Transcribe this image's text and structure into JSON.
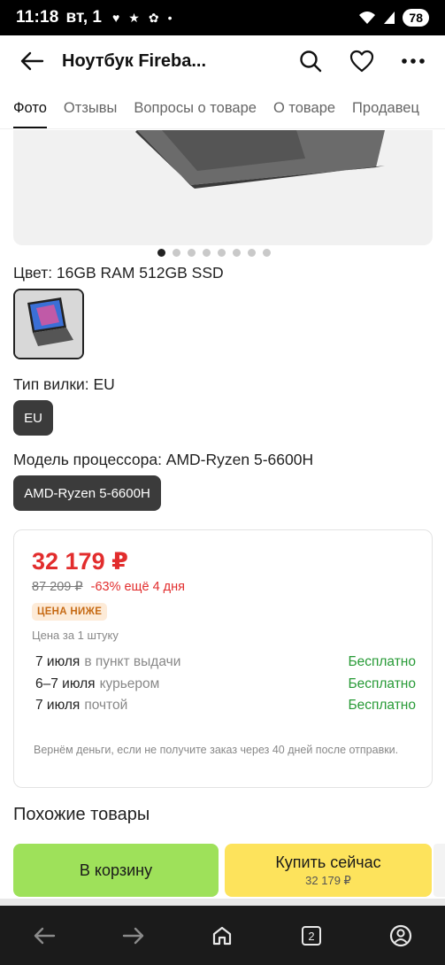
{
  "status_bar": {
    "time": "11:18",
    "day": "вт, 1",
    "battery": "78"
  },
  "header": {
    "title": "Ноутбук Fireba..."
  },
  "tabs": [
    {
      "label": "Фото"
    },
    {
      "label": "Отзывы"
    },
    {
      "label": "Вопросы о товаре"
    },
    {
      "label": "О товаре"
    },
    {
      "label": "Продавец"
    }
  ],
  "gallery": {
    "dot_count": 8,
    "active_index": 0
  },
  "options": {
    "color_label": "Цвет: 16GB RAM 512GB SSD",
    "plug_label": "Тип вилки: EU",
    "plug_value": "EU",
    "cpu_label": "Модель процессора: AMD-Ryzen 5-6600H",
    "cpu_value": "AMD-Ryzen 5-6600H"
  },
  "price_card": {
    "price": "32 179 ₽",
    "old_price": "87 209 ₽",
    "discount": "-63% ещё 4 дня",
    "badge": "ЦЕНА НИЖЕ",
    "unit": "Цена за 1 штуку",
    "delivery": [
      {
        "date": "7 июля",
        "method": "в пункт выдачи",
        "cost": "Бесплатно"
      },
      {
        "date": "6–7 июля",
        "method": "курьером",
        "cost": "Бесплатно"
      },
      {
        "date": "7 июля",
        "method": "почтой",
        "cost": "Бесплатно"
      }
    ],
    "note": "Вернём деньги, если не получите заказ через 40 дней после отправки."
  },
  "similar_title": "Похожие товары",
  "actions": {
    "cart": "В корзину",
    "buy": "Купить сейчас",
    "buy_price": "32 179 ₽"
  },
  "nav": {
    "tabs_count": "2"
  },
  "colors": {
    "price": "#e22d2d",
    "free": "#279a36",
    "cart_btn": "#9ee15a",
    "buy_btn": "#fde35c"
  }
}
